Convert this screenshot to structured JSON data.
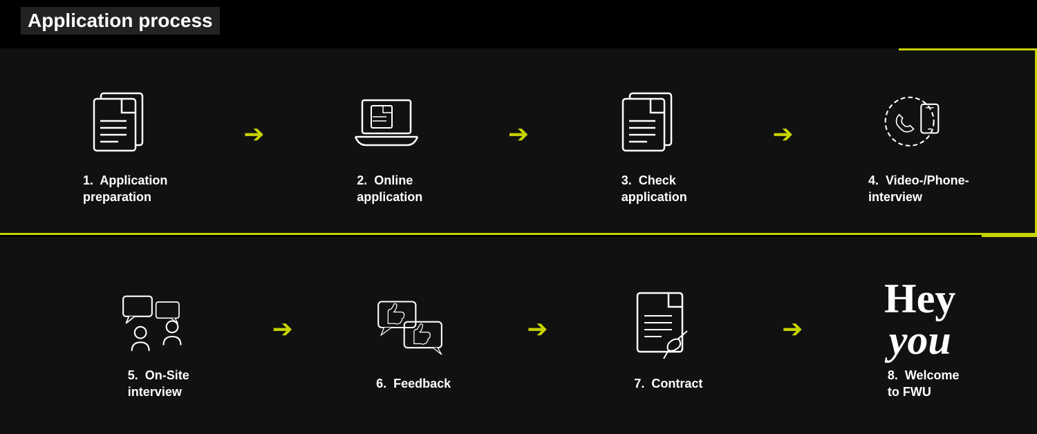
{
  "page": {
    "title": "Application process"
  },
  "top_steps": [
    {
      "number": "1.",
      "label": "Application\npreparation",
      "icon": "document-icon"
    },
    {
      "number": "2.",
      "label": "Online\napplication",
      "icon": "laptop-icon"
    },
    {
      "number": "3.",
      "label": "Check\napplication",
      "icon": "document-check-icon"
    },
    {
      "number": "4.",
      "label": "Video-/Phone-\ninterview",
      "icon": "phone-icon"
    }
  ],
  "bottom_steps": [
    {
      "number": "5.",
      "label": "On-Site\ninterview",
      "icon": "interview-icon"
    },
    {
      "number": "6.",
      "label": "Feedback",
      "icon": "feedback-icon"
    },
    {
      "number": "7.",
      "label": "Contract",
      "icon": "contract-icon"
    },
    {
      "number": "8.",
      "label": "Welcome\nto FWU",
      "icon": "welcome-icon"
    }
  ],
  "arrow_symbol": "→",
  "accent_color": "#c8d400",
  "hey_you_text_line1": "Hey",
  "hey_you_text_line2": "you"
}
